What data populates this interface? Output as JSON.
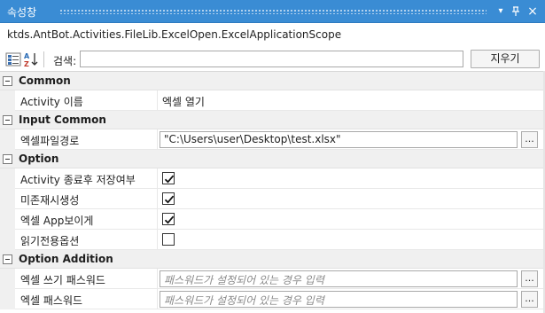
{
  "window": {
    "title": "속성창",
    "buttons": {
      "dropdown": "▾",
      "pin": "ᵖ",
      "close": "×"
    }
  },
  "scope": "ktds.AntBot.Activities.FileLib.ExcelOpen.ExcelApplicationScope",
  "toolbar": {
    "search_label": "검색:",
    "search_value": "",
    "clear_label": "지우기",
    "icons": [
      "categorized-view-icon",
      "alphabetical-sort-icon"
    ]
  },
  "categories": [
    {
      "label": "Common",
      "rows": [
        {
          "name": "Activity 이름",
          "type": "text",
          "value": "엑셀 열기"
        }
      ]
    },
    {
      "label": "Input Common",
      "rows": [
        {
          "name": "엑셀파일경로",
          "type": "input",
          "value": "\"C:\\Users\\user\\Desktop\\test.xlsx\"",
          "button": "..."
        }
      ]
    },
    {
      "label": "Option",
      "rows": [
        {
          "name": "Activity 종료후 저장여부",
          "type": "checkbox",
          "checked": true
        },
        {
          "name": "미존재시생성",
          "type": "checkbox",
          "checked": true
        },
        {
          "name": "엑셀 App보이게",
          "type": "checkbox",
          "checked": true
        },
        {
          "name": "읽기전용옵션",
          "type": "checkbox",
          "checked": false
        }
      ]
    },
    {
      "label": "Option Addition",
      "rows": [
        {
          "name": "엑셀 쓰기 패스워드",
          "type": "input",
          "placeholder": "패스워드가 설정되어 있는 경우 입력",
          "button": "..."
        },
        {
          "name": "엑셀 패스워드",
          "type": "input",
          "placeholder": "패스워드가 설정되어 있는 경우 입력",
          "button": "..."
        }
      ]
    }
  ],
  "colors": {
    "titlebar": "#3a8cd4",
    "category_bg": "#f0f0f0"
  }
}
